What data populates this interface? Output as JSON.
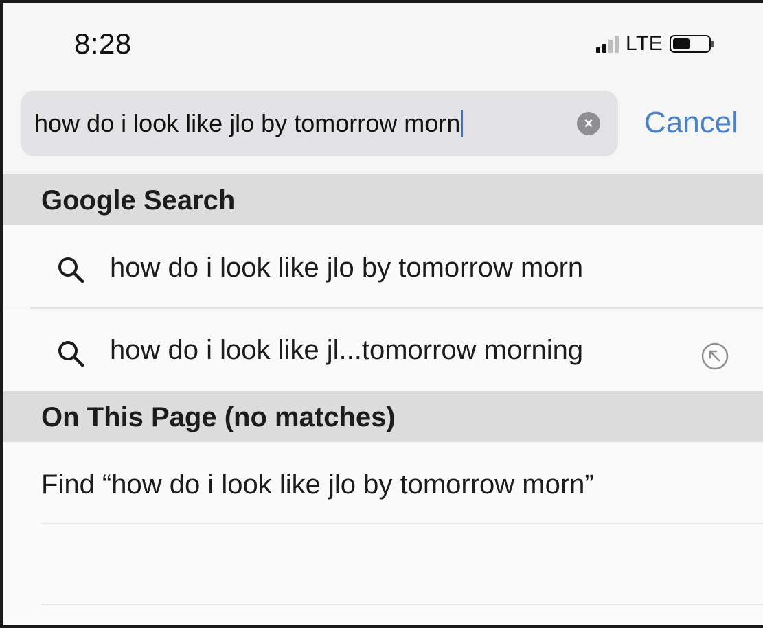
{
  "status_bar": {
    "time": "8:28",
    "carrier": "LTE",
    "signal_bars_filled": 2,
    "signal_bars_total": 4
  },
  "search": {
    "query": "how do i look like jlo by tomorrow morn",
    "cancel_label": "Cancel",
    "clear_icon": "clear-circle-icon"
  },
  "google_section": {
    "header": "Google Search",
    "suggestions": [
      {
        "text": "how do i look like jlo by tomorrow morn",
        "icon": "search-icon"
      },
      {
        "text": "how do i look like jl...tomorrow morning",
        "icon": "search-icon",
        "trailing_icon": "fill-suggestion-arrow-icon"
      }
    ]
  },
  "page_section": {
    "header": "On This Page (no matches)",
    "find_label": "Find “how do i look like jlo by tomorrow morn”"
  },
  "colors": {
    "accent": "#4a82c9",
    "caret": "#2f6fd6",
    "section_header_bg": "#dcdcdc",
    "search_field_bg": "#e3e3e5"
  }
}
